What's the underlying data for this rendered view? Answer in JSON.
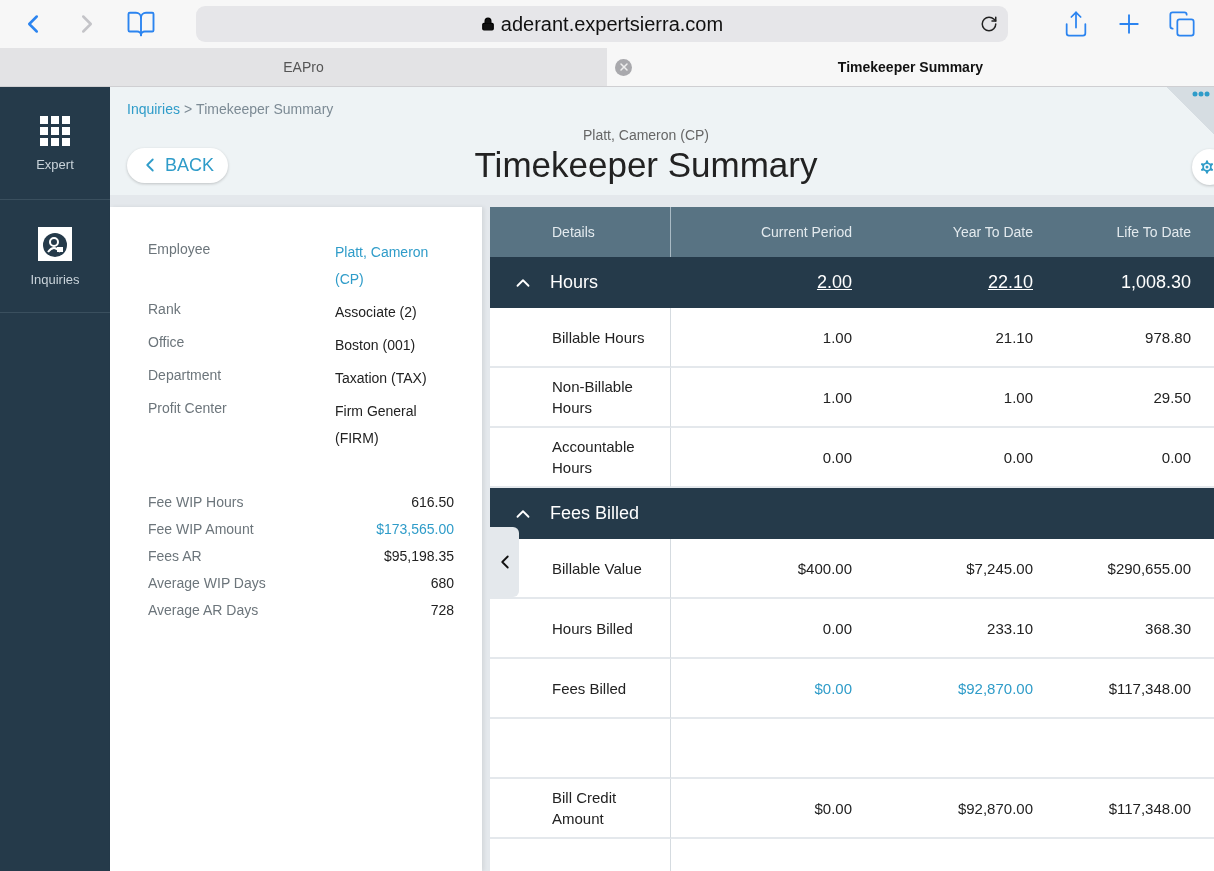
{
  "browser": {
    "address": "aderant.expertsierra.com",
    "tabs": [
      {
        "label": "EAPro",
        "selected": false
      },
      {
        "label": "Timekeeper Summary",
        "selected": true
      }
    ]
  },
  "sidebar": {
    "items": [
      {
        "label": "Expert",
        "kind": "grid"
      },
      {
        "label": "Inquiries",
        "kind": "inquiry"
      }
    ]
  },
  "breadcrumb": {
    "link": "Inquiries",
    "separator": ">",
    "current": "Timekeeper Summary"
  },
  "header": {
    "subtitle": "Platt, Cameron (CP)",
    "title": "Timekeeper Summary",
    "back_button": "BACK"
  },
  "details": [
    {
      "label": "Employee",
      "value": "Platt, Cameron (CP)",
      "kind": "link"
    },
    {
      "label": "Rank",
      "value": "Associate (2)",
      "kind": "plain"
    },
    {
      "label": "Office",
      "value": "Boston (001)",
      "kind": "plain"
    },
    {
      "label": "Department",
      "value": "Taxation (TAX)",
      "kind": "plain"
    },
    {
      "label": "Profit Center",
      "value": "Firm General (FIRM)",
      "kind": "plain"
    }
  ],
  "totals": [
    {
      "label": "Fee WIP Hours",
      "value": "616.50",
      "kind": "plain"
    },
    {
      "label": "Fee WIP Amount",
      "value": "$173,565.00",
      "kind": "link"
    },
    {
      "label": "Fees AR",
      "value": "$95,198.35",
      "kind": "plain"
    },
    {
      "label": "Average WIP Days",
      "value": "680",
      "kind": "plain"
    },
    {
      "label": "Average AR Days",
      "value": "728",
      "kind": "plain"
    }
  ],
  "table": {
    "columns": [
      "Details",
      "Current Period",
      "Year To Date",
      "Life To Date"
    ],
    "rows": [
      {
        "kind": "group",
        "label": "Hours",
        "expanded": true,
        "cells": [
          {
            "text": "2.00",
            "kind": "underlined"
          },
          {
            "text": "22.10",
            "kind": "underlined"
          },
          {
            "text": "1,008.30",
            "kind": "plain"
          }
        ]
      },
      {
        "kind": "data",
        "label": "Billable Hours",
        "cells": [
          {
            "text": "1.00",
            "kind": "plain"
          },
          {
            "text": "21.10",
            "kind": "plain"
          },
          {
            "text": "978.80",
            "kind": "plain"
          }
        ]
      },
      {
        "kind": "data",
        "label": "Non-Billable Hours",
        "cells": [
          {
            "text": "1.00",
            "kind": "plain"
          },
          {
            "text": "1.00",
            "kind": "plain"
          },
          {
            "text": "29.50",
            "kind": "plain"
          }
        ]
      },
      {
        "kind": "data",
        "label": "Accountable Hours",
        "cells": [
          {
            "text": "0.00",
            "kind": "plain"
          },
          {
            "text": "0.00",
            "kind": "plain"
          },
          {
            "text": "0.00",
            "kind": "plain"
          }
        ]
      },
      {
        "kind": "group",
        "label": "Fees Billed",
        "expanded": true
      },
      {
        "kind": "data",
        "label": "Billable Value",
        "cells": [
          {
            "text": "$400.00",
            "kind": "plain"
          },
          {
            "text": "$7,245.00",
            "kind": "plain"
          },
          {
            "text": "$290,655.00",
            "kind": "plain"
          }
        ]
      },
      {
        "kind": "data",
        "label": "Hours Billed",
        "cells": [
          {
            "text": "0.00",
            "kind": "plain"
          },
          {
            "text": "233.10",
            "kind": "plain"
          },
          {
            "text": "368.30",
            "kind": "plain"
          }
        ]
      },
      {
        "kind": "data",
        "label": "Fees Billed",
        "cells": [
          {
            "text": "$0.00",
            "kind": "link"
          },
          {
            "text": "$92,870.00",
            "kind": "link"
          },
          {
            "text": "$117,348.00",
            "kind": "plain"
          }
        ]
      },
      {
        "kind": "blank"
      },
      {
        "kind": "data",
        "label": "Bill Credit Amount",
        "cells": [
          {
            "text": "$0.00",
            "kind": "plain"
          },
          {
            "text": "$92,870.00",
            "kind": "plain"
          },
          {
            "text": "$117,348.00",
            "kind": "plain"
          }
        ]
      },
      {
        "kind": "blank"
      }
    ]
  }
}
